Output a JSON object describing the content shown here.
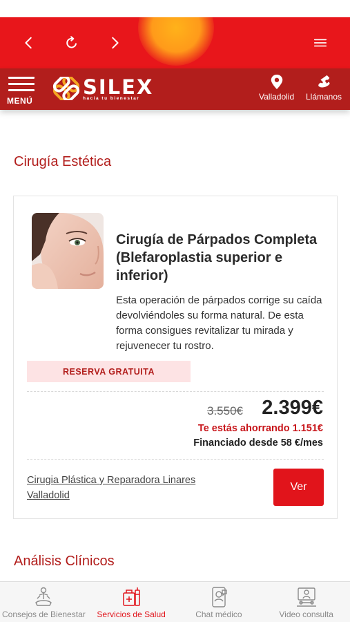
{
  "browser": {
    "back_icon": "chevron-left-icon",
    "reload_icon": "reload-icon",
    "forward_icon": "chevron-right-icon",
    "menu_icon": "hamburger-icon",
    "bar_color": "#e8161b"
  },
  "header": {
    "menu_label": "MENÚ",
    "logo_name": "SILEX",
    "logo_tagline": "hacia tu bienestar",
    "location_label": "Valladolid",
    "call_label": "Llámanos",
    "bg_color": "#b21e1c"
  },
  "sections": {
    "first_title": "Cirugía Estética",
    "second_title": "Análisis Clínicos"
  },
  "offer": {
    "title": "Cirugía de Párpados Completa (Blefaroplastia superior e inferior)",
    "description": "Esta operación de párpados corrige su caída devolviéndoles su forma natural. De esta forma consigues revitalizar tu mirada y rejuvenecer tu rostro.",
    "badge": "RESERVA GRATUITA",
    "old_price": "3.550€",
    "new_price": "2.399€",
    "saving": "Te estás ahorrando 1.151€",
    "financing": "Financiado desde 58 €/mes",
    "clinic": "Cirugia Plástica y Reparadora Linares Valladolid",
    "button": "Ver"
  },
  "tabs": [
    {
      "label": "Consejos de Bienestar",
      "icon": "meditation-icon",
      "active": false
    },
    {
      "label": "Servicios de Salud",
      "icon": "medical-kit-icon",
      "active": true
    },
    {
      "label": "Chat médico",
      "icon": "chat-doctor-icon",
      "active": false
    },
    {
      "label": "Video consulta",
      "icon": "video-consult-icon",
      "active": false
    }
  ],
  "colors": {
    "accent": "#e1141b",
    "title_red": "#b21e1c",
    "badge_bg": "#fde3e4"
  }
}
